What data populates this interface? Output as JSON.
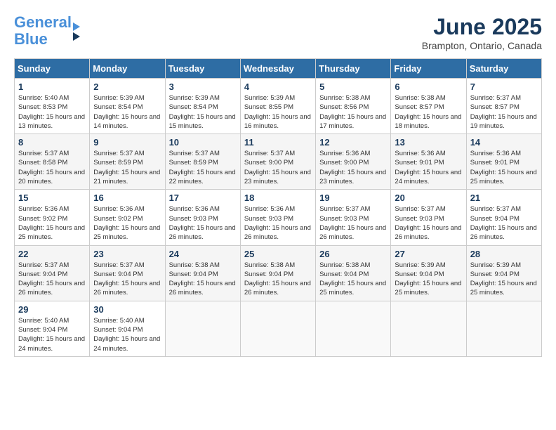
{
  "header": {
    "logo_line1": "General",
    "logo_line2": "Blue",
    "month_title": "June 2025",
    "location": "Brampton, Ontario, Canada"
  },
  "days_of_week": [
    "Sunday",
    "Monday",
    "Tuesday",
    "Wednesday",
    "Thursday",
    "Friday",
    "Saturday"
  ],
  "weeks": [
    [
      {
        "day": "1",
        "sunrise": "5:40 AM",
        "sunset": "8:53 PM",
        "daylight": "15 hours and 13 minutes."
      },
      {
        "day": "2",
        "sunrise": "5:39 AM",
        "sunset": "8:54 PM",
        "daylight": "15 hours and 14 minutes."
      },
      {
        "day": "3",
        "sunrise": "5:39 AM",
        "sunset": "8:54 PM",
        "daylight": "15 hours and 15 minutes."
      },
      {
        "day": "4",
        "sunrise": "5:39 AM",
        "sunset": "8:55 PM",
        "daylight": "15 hours and 16 minutes."
      },
      {
        "day": "5",
        "sunrise": "5:38 AM",
        "sunset": "8:56 PM",
        "daylight": "15 hours and 17 minutes."
      },
      {
        "day": "6",
        "sunrise": "5:38 AM",
        "sunset": "8:57 PM",
        "daylight": "15 hours and 18 minutes."
      },
      {
        "day": "7",
        "sunrise": "5:37 AM",
        "sunset": "8:57 PM",
        "daylight": "15 hours and 19 minutes."
      }
    ],
    [
      {
        "day": "8",
        "sunrise": "5:37 AM",
        "sunset": "8:58 PM",
        "daylight": "15 hours and 20 minutes."
      },
      {
        "day": "9",
        "sunrise": "5:37 AM",
        "sunset": "8:59 PM",
        "daylight": "15 hours and 21 minutes."
      },
      {
        "day": "10",
        "sunrise": "5:37 AM",
        "sunset": "8:59 PM",
        "daylight": "15 hours and 22 minutes."
      },
      {
        "day": "11",
        "sunrise": "5:37 AM",
        "sunset": "9:00 PM",
        "daylight": "15 hours and 23 minutes."
      },
      {
        "day": "12",
        "sunrise": "5:36 AM",
        "sunset": "9:00 PM",
        "daylight": "15 hours and 23 minutes."
      },
      {
        "day": "13",
        "sunrise": "5:36 AM",
        "sunset": "9:01 PM",
        "daylight": "15 hours and 24 minutes."
      },
      {
        "day": "14",
        "sunrise": "5:36 AM",
        "sunset": "9:01 PM",
        "daylight": "15 hours and 25 minutes."
      }
    ],
    [
      {
        "day": "15",
        "sunrise": "5:36 AM",
        "sunset": "9:02 PM",
        "daylight": "15 hours and 25 minutes."
      },
      {
        "day": "16",
        "sunrise": "5:36 AM",
        "sunset": "9:02 PM",
        "daylight": "15 hours and 25 minutes."
      },
      {
        "day": "17",
        "sunrise": "5:36 AM",
        "sunset": "9:03 PM",
        "daylight": "15 hours and 26 minutes."
      },
      {
        "day": "18",
        "sunrise": "5:36 AM",
        "sunset": "9:03 PM",
        "daylight": "15 hours and 26 minutes."
      },
      {
        "day": "19",
        "sunrise": "5:37 AM",
        "sunset": "9:03 PM",
        "daylight": "15 hours and 26 minutes."
      },
      {
        "day": "20",
        "sunrise": "5:37 AM",
        "sunset": "9:03 PM",
        "daylight": "15 hours and 26 minutes."
      },
      {
        "day": "21",
        "sunrise": "5:37 AM",
        "sunset": "9:04 PM",
        "daylight": "15 hours and 26 minutes."
      }
    ],
    [
      {
        "day": "22",
        "sunrise": "5:37 AM",
        "sunset": "9:04 PM",
        "daylight": "15 hours and 26 minutes."
      },
      {
        "day": "23",
        "sunrise": "5:37 AM",
        "sunset": "9:04 PM",
        "daylight": "15 hours and 26 minutes."
      },
      {
        "day": "24",
        "sunrise": "5:38 AM",
        "sunset": "9:04 PM",
        "daylight": "15 hours and 26 minutes."
      },
      {
        "day": "25",
        "sunrise": "5:38 AM",
        "sunset": "9:04 PM",
        "daylight": "15 hours and 26 minutes."
      },
      {
        "day": "26",
        "sunrise": "5:38 AM",
        "sunset": "9:04 PM",
        "daylight": "15 hours and 25 minutes."
      },
      {
        "day": "27",
        "sunrise": "5:39 AM",
        "sunset": "9:04 PM",
        "daylight": "15 hours and 25 minutes."
      },
      {
        "day": "28",
        "sunrise": "5:39 AM",
        "sunset": "9:04 PM",
        "daylight": "15 hours and 25 minutes."
      }
    ],
    [
      {
        "day": "29",
        "sunrise": "5:40 AM",
        "sunset": "9:04 PM",
        "daylight": "15 hours and 24 minutes."
      },
      {
        "day": "30",
        "sunrise": "5:40 AM",
        "sunset": "9:04 PM",
        "daylight": "15 hours and 24 minutes."
      },
      null,
      null,
      null,
      null,
      null
    ]
  ]
}
